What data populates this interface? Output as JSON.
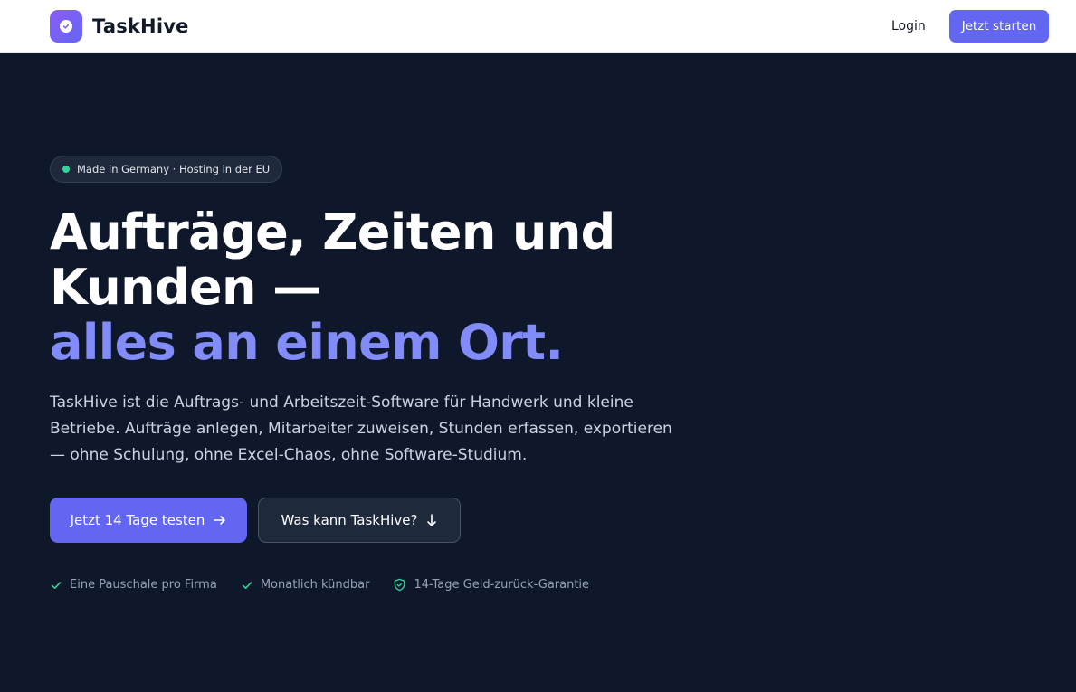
{
  "header": {
    "brand": "TaskHive",
    "login_label": "Login",
    "cta_label": "Jetzt starten"
  },
  "hero": {
    "badge": "Made in Germany · Hosting in der EU",
    "headline_line1": "Aufträge, Zeiten und",
    "headline_line2": "Kunden —",
    "headline_line3": "alles an einem Ort.",
    "lead": "TaskHive ist die Auftrags- und Arbeitszeit-Software für Handwerk und kleine Betriebe. Aufträge anlegen, Mitarbeiter zuweisen, Stunden erfassen, exportieren — ohne Schulung, ohne Excel-Chaos, ohne Software-Studium.",
    "primary_button": "Jetzt 14 Tage testen",
    "secondary_button": "Was kann TaskHive?",
    "features": [
      {
        "label": "Eine Pauschale pro Firma",
        "icon": "check-icon"
      },
      {
        "label": "Monatlich kündbar",
        "icon": "check-icon"
      },
      {
        "label": "14-Tage Geld-zurück-Garantie",
        "icon": "shield-check-icon"
      }
    ]
  },
  "colors": {
    "background": "#0f172a",
    "accent": "#6366f1",
    "accent_text": "#818cf8",
    "feature_icon": "#34d399"
  }
}
